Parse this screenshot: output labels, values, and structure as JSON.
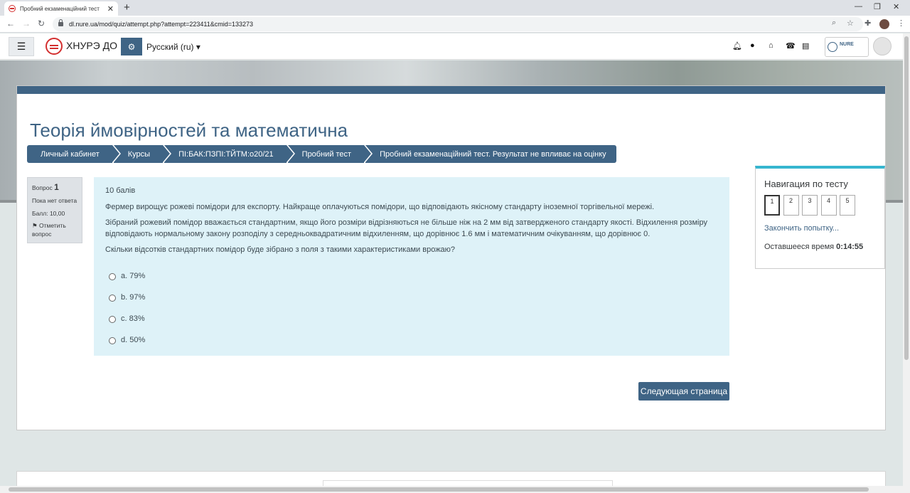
{
  "browser": {
    "tab_title": "Пробний екзаменаційний тест",
    "tab_close": "✕",
    "new_tab": "+",
    "url": "dl.nure.ua/mod/quiz/attempt.php?attempt=223411&cmid=133273"
  },
  "navbar": {
    "brand": "ХНУРЭ ДО",
    "language": "Русский ‎(ru)‎",
    "nure_logo_text": "NURE"
  },
  "page": {
    "title": "Теорія ймовірностей та математична"
  },
  "breadcrumb": [
    {
      "label": "Личный кабинет"
    },
    {
      "label": "Курсы"
    },
    {
      "label": "ПІ:БАК:ПЗПІ:ТЙТМ:о20/21"
    },
    {
      "label": "Пробний тест"
    },
    {
      "label": "Пробний екзаменаційний тест. Результат не впливає на оцінку"
    }
  ],
  "question_info": {
    "label": "Вопрос",
    "number": "1",
    "state": "Пока нет ответа",
    "mark": "Балл: 10,00",
    "flag_label": "Отметить вопрос"
  },
  "question": {
    "grade": "10 балів",
    "text1": "Фермер вирощує рожеві помідори для експорту. Найкраще оплачуються помідори, що відповідають якісному стандарту іноземної торгівельної мережі.",
    "text2": "Зібраний рожевий помідор вважається стандартним, якщо його розміри відрізняються не більше ніж на 2 мм від затвердженого стандарту якості. Відхилення розміру відповідають нормальному закону розподілу з середньоквадратичним відхиленням, що дорівнює 1.6 мм і математичним очікуванням, що дорівнює 0.",
    "text3": "Скільки відсотків стандартних помідор буде зібрано з поля з такими характеристиками врожаю?",
    "answers": [
      {
        "label": "a. 79%"
      },
      {
        "label": "b. 97%"
      },
      {
        "label": "c. 83%"
      },
      {
        "label": "d. 50%"
      }
    ]
  },
  "next_button": "Следующая страница",
  "quiz_nav": {
    "title": "Навигация по тесту",
    "buttons": [
      "1",
      "2",
      "3",
      "4",
      "5"
    ],
    "current": "1",
    "finish_link": "Закончить попытку...",
    "timer_label": "Оставшееся время",
    "timer_value": "0:14:55"
  },
  "colors": {
    "primary": "#3f6485",
    "question_bg": "#def2f8",
    "nav_accent": "#36b6cf",
    "brand_red": "#d32f2f"
  }
}
